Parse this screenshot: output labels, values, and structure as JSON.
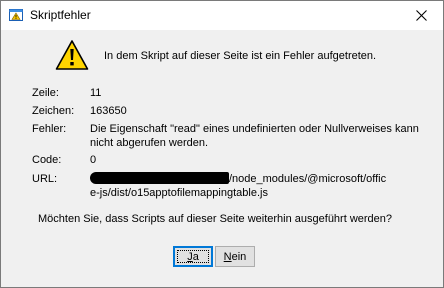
{
  "window": {
    "title": "Skriptfehler",
    "close_glyph": "✕"
  },
  "message": {
    "intro": "In dem Skript auf dieser Seite ist ein Fehler aufgetreten."
  },
  "details": {
    "line_label": "Zeile:",
    "line_value": "11",
    "char_label": "Zeichen:",
    "char_value": "163650",
    "error_label": "Fehler:",
    "error_value_1": "Die Eigenschaft \"read\" eines undefinierten oder Nullverweises kann",
    "error_value_2": "nicht abgerufen werden.",
    "code_label": "Code:",
    "code_value": "0",
    "url_label": "URL:",
    "url_value_1": "/node_modules/@microsoft/offic",
    "url_value_2": "e-js/dist/o15apptofilemappingtable.js"
  },
  "question": "Möchten Sie, dass Scripts auf dieser Seite weiterhin ausgeführt werden?",
  "buttons": {
    "yes_acc": "J",
    "yes_rest": "a",
    "no_acc": "N",
    "no_rest": "ein"
  },
  "icons": {
    "title": "script-error-icon",
    "warning": "warning-icon",
    "close": "close-icon"
  },
  "colors": {
    "warning_fill": "#ffd500",
    "accent_border": "#0078d7"
  }
}
